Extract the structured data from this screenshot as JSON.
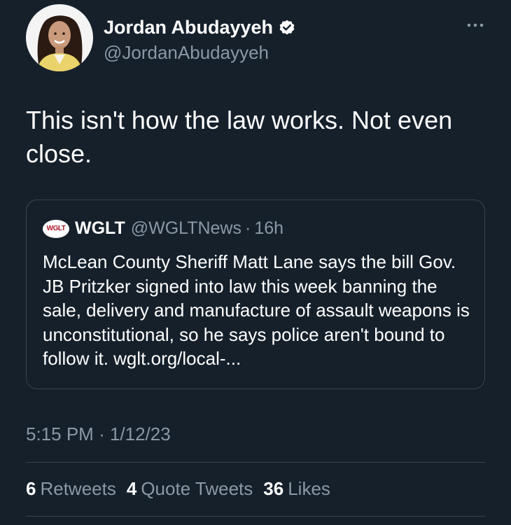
{
  "author": {
    "name": "Jordan Abudayyeh",
    "handle": "@JordanAbudayyeh",
    "verified": true
  },
  "tweet": {
    "text": "This isn't how the law works. Not even close."
  },
  "quote": {
    "logo_text": "WGLT",
    "name": "WGLT",
    "handle": "@WGLTNews",
    "separator": "·",
    "time": "16h",
    "text": "McLean County Sheriff Matt Lane says the bill Gov. JB Pritzker signed into law this week banning the sale, delivery and manufacture of assault weapons is unconstitutional, so he says police aren't bound to follow it. wglt.org/local-..."
  },
  "meta": {
    "time": "5:15 PM",
    "separator": "·",
    "date": "1/12/23"
  },
  "stats": {
    "retweets_count": "6",
    "retweets_label": "Retweets",
    "quotes_count": "4",
    "quotes_label": "Quote Tweets",
    "likes_count": "36",
    "likes_label": "Likes"
  },
  "colors": {
    "background": "#15202b",
    "text_primary": "#ffffff",
    "text_secondary": "#8b98a5",
    "border": "#38444d",
    "verified_badge": "#ffffff",
    "wglt_brand": "#b3192a"
  },
  "icons": {
    "verified": "verified-badge-icon",
    "more": "more-horizontal-icon",
    "avatar": "profile-photo"
  }
}
